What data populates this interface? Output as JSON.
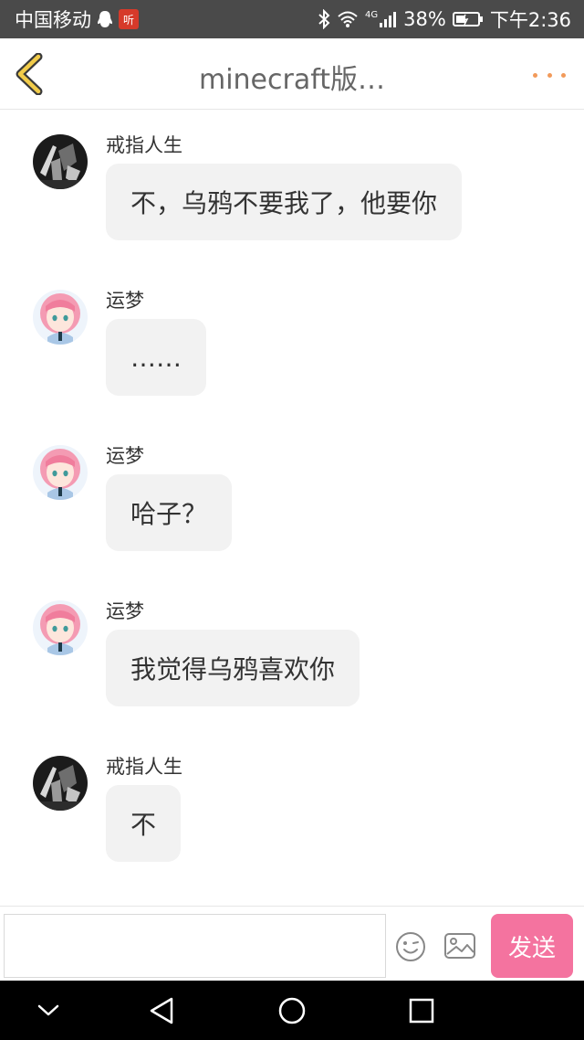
{
  "status_bar": {
    "carrier": "中国移动",
    "network": "4G",
    "battery": "38%",
    "time": "下午2:36",
    "icons": [
      "qq-icon",
      "notification-app-icon",
      "bluetooth-icon",
      "wifi-icon",
      "signal-icon",
      "battery-icon"
    ]
  },
  "header": {
    "title": "minecraft版…",
    "back_icon": "chevron-left-icon",
    "more_icon": "more-dots-icon",
    "accent_color": "#f29a5a"
  },
  "messages": [
    {
      "sender": "戒指人生",
      "text": "不，乌鸦不要我了，他要你",
      "avatar": "dark-avatar"
    },
    {
      "sender": "运梦",
      "text": "……",
      "avatar": "anime-avatar"
    },
    {
      "sender": "运梦",
      "text": "哈子？",
      "avatar": "anime-avatar"
    },
    {
      "sender": "运梦",
      "text": "我觉得乌鸦喜欢你",
      "avatar": "anime-avatar"
    },
    {
      "sender": "戒指人生",
      "text": "不",
      "avatar": "dark-avatar"
    }
  ],
  "input_bar": {
    "placeholder": "",
    "value": "",
    "send_label": "发送",
    "send_color": "#f4739f",
    "icons": [
      "emoji-icon",
      "image-icon"
    ]
  },
  "nav_bar": {
    "icons": [
      "hide-keyboard-icon",
      "back-triangle-icon",
      "home-circle-icon",
      "recents-square-icon"
    ]
  }
}
